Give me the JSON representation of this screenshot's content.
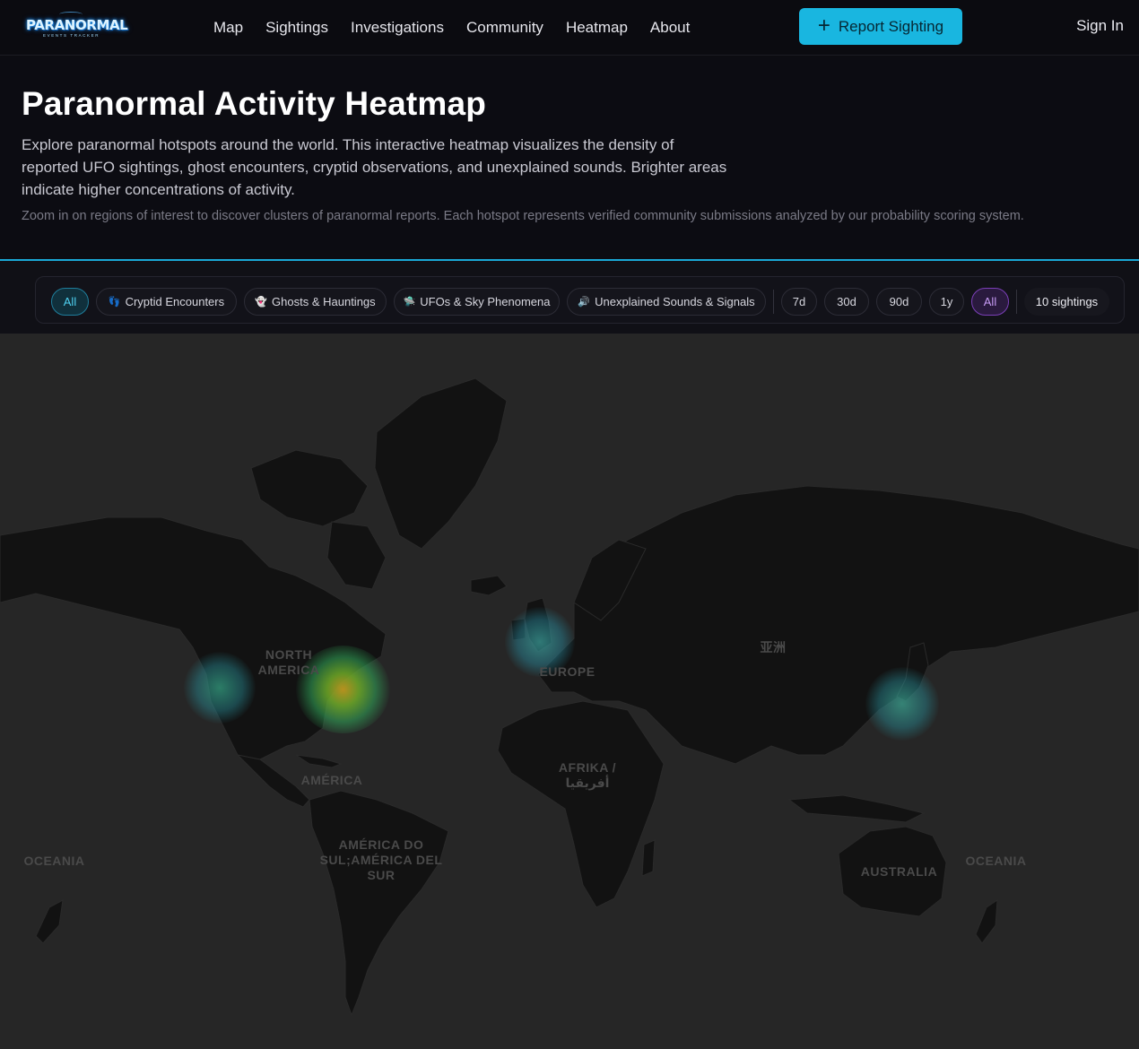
{
  "nav": {
    "logo": {
      "main": "PARANORMAL",
      "sub": "EVENTS TRACKER"
    },
    "links": [
      "Map",
      "Sightings",
      "Investigations",
      "Community",
      "Heatmap",
      "About"
    ],
    "report_button": "Report Sighting",
    "sign_in": "Sign In",
    "colors": {
      "accent": "#19b6e0"
    }
  },
  "hero": {
    "title": "Paranormal Activity Heatmap",
    "description": "Explore paranormal hotspots around the world. This interactive heatmap visualizes the density of reported UFO sightings, ghost encounters, cryptid observations, and unexplained sounds. Brighter areas indicate higher concentrations of activity.",
    "note": "Zoom in on regions of interest to discover clusters of paranormal reports. Each hotspot represents verified community submissions analyzed by our probability scoring system."
  },
  "filters": {
    "categories": [
      {
        "label": "All",
        "icon": "",
        "active": true
      },
      {
        "label": "Cryptid Encounters",
        "icon": "footprint-icon",
        "active": false
      },
      {
        "label": "Ghosts & Hauntings",
        "icon": "ghost-icon",
        "active": false
      },
      {
        "label": "UFOs & Sky Phenomena",
        "icon": "ufo-icon",
        "active": false
      },
      {
        "label": "Unexplained Sounds & Signals",
        "icon": "speaker-icon",
        "active": false
      }
    ],
    "time_ranges": [
      {
        "label": "7d",
        "active": false
      },
      {
        "label": "30d",
        "active": false
      },
      {
        "label": "90d",
        "active": false
      },
      {
        "label": "1y",
        "active": false
      },
      {
        "label": "All",
        "active": true
      }
    ],
    "count": "10 sightings"
  },
  "map": {
    "labels": {
      "north_america": "NORTH AMERICA",
      "america": "AMÉRICA",
      "south_america": "AMÉRICA DO SUL;AMÉRICA DEL SUR",
      "europe": "EUROPE",
      "africa": "AFRIKA / أفريقيا",
      "asia": "亚洲",
      "australia": "AUSTRALIA",
      "oceania_left": "OCEANIA",
      "oceania_right": "OCEANIA"
    },
    "hotspots": [
      {
        "region": "US West Coast",
        "intensity": "low"
      },
      {
        "region": "US East Coast",
        "intensity": "high"
      },
      {
        "region": "British Isles",
        "intensity": "low"
      },
      {
        "region": "Japan",
        "intensity": "low"
      }
    ]
  }
}
